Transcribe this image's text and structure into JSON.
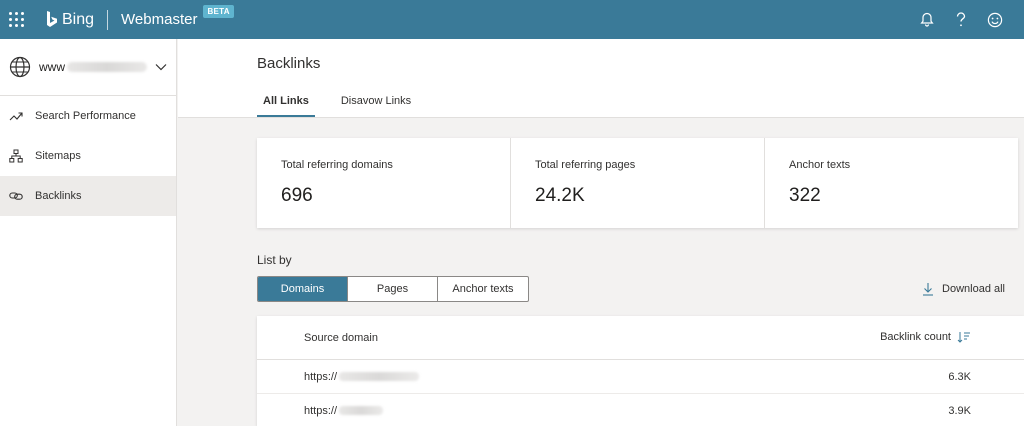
{
  "topbar": {
    "brand": "Bing",
    "product": "Webmaster",
    "badge": "BETA"
  },
  "sidebar": {
    "site_prefix": "www",
    "items": [
      {
        "label": "Search Performance",
        "icon": "trend-line-icon"
      },
      {
        "label": "Sitemaps",
        "icon": "sitemap-icon"
      },
      {
        "label": "Backlinks",
        "icon": "link-icon",
        "active": true
      }
    ]
  },
  "page": {
    "title": "Backlinks",
    "tabs": [
      {
        "label": "All Links",
        "active": true
      },
      {
        "label": "Disavow Links"
      }
    ]
  },
  "stats": [
    {
      "label": "Total referring domains",
      "value": "696"
    },
    {
      "label": "Total referring pages",
      "value": "24.2K"
    },
    {
      "label": "Anchor texts",
      "value": "322"
    }
  ],
  "listby": {
    "label": "List by",
    "options": [
      "Domains",
      "Pages",
      "Anchor texts"
    ],
    "selected": "Domains",
    "download_label": "Download all"
  },
  "table": {
    "columns": [
      "Source domain",
      "Backlink count"
    ],
    "rows": [
      {
        "source_prefix": "https://",
        "count": "6.3K"
      },
      {
        "source_prefix": "https://",
        "count": "3.9K"
      }
    ]
  },
  "colors": {
    "accent": "#3a7a98",
    "badge": "#5fb4cf"
  }
}
